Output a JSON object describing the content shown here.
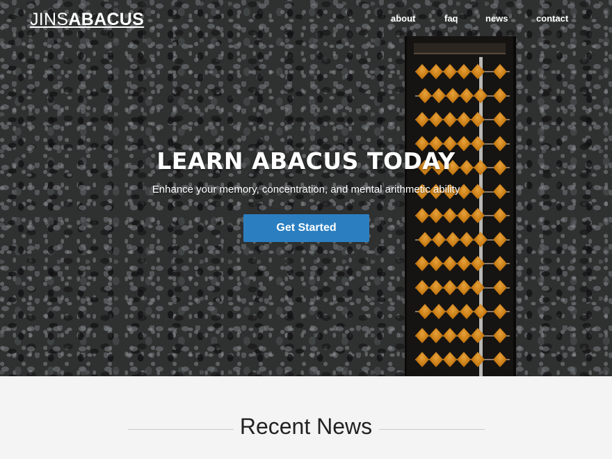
{
  "brand": {
    "light": "JINS",
    "bold": "ABACUS"
  },
  "nav": {
    "items": [
      "about",
      "faq",
      "news",
      "contact"
    ]
  },
  "hero": {
    "title": "LEARN ABACUS TODAY",
    "subtitle": "Enhance your memory, concentration, and mental arithmetic ability",
    "cta_label": "Get Started",
    "image": "abacus-on-granite"
  },
  "news": {
    "heading": "Recent News"
  },
  "colors": {
    "accent": "#2b7fc1",
    "hero_bg": "#3a3b3b",
    "section_bg": "#f4f4f4",
    "bead": "#c77a12"
  }
}
